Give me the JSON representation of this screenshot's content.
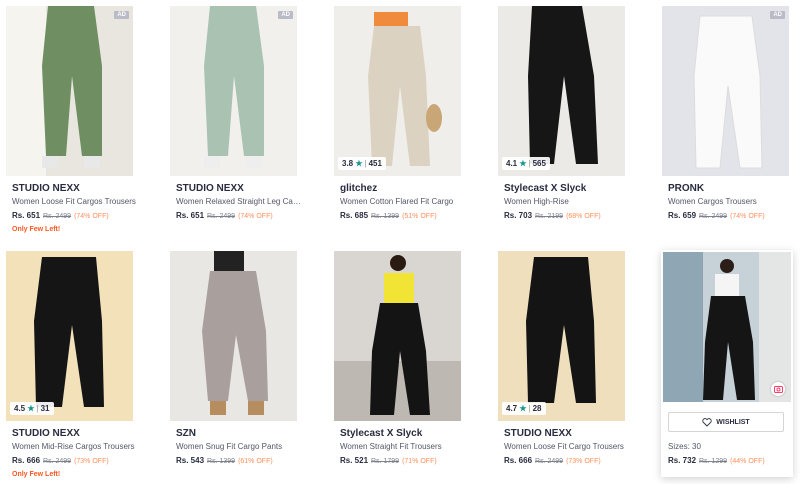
{
  "products": [
    {
      "brand": "STUDIO NEXX",
      "name": "Women Loose Fit Cargos Trousers",
      "price": "Rs. 651",
      "mrp": "Rs. 2499",
      "discount": "(74% OFF)",
      "ad": "AD",
      "note": "Only Few Left!"
    },
    {
      "brand": "STUDIO NEXX",
      "name": "Women Relaxed Straight Leg Cargos",
      "price": "Rs. 651",
      "mrp": "Rs. 2499",
      "discount": "(74% OFF)",
      "ad": "AD"
    },
    {
      "brand": "glitchez",
      "name": "Women Cotton Flared Fit Cargo",
      "price": "Rs. 685",
      "mrp": "Rs. 1399",
      "discount": "(51% OFF)",
      "rating": "3.8",
      "count": "451"
    },
    {
      "brand": "Stylecast X Slyck",
      "name": "Women High-Rise",
      "price": "Rs. 703",
      "mrp": "Rs. 2199",
      "discount": "(68% OFF)",
      "rating": "4.1",
      "count": "565"
    },
    {
      "brand": "PRONK",
      "name": "Women Cargos Trousers",
      "price": "Rs. 659",
      "mrp": "Rs. 2499",
      "discount": "(74% OFF)",
      "ad": "AD"
    },
    {
      "brand": "STUDIO NEXX",
      "name": "Women Mid-Rise Cargos Trousers",
      "price": "Rs. 666",
      "mrp": "Rs. 2499",
      "discount": "(73% OFF)",
      "rating": "4.5",
      "count": "31",
      "note": "Only Few Left!"
    },
    {
      "brand": "SZN",
      "name": "Women Snug Fit Cargo Pants",
      "price": "Rs. 543",
      "mrp": "Rs. 1399",
      "discount": "(61% OFF)"
    },
    {
      "brand": "Stylecast X Slyck",
      "name": "Women Straight Fit Trousers",
      "price": "Rs. 521",
      "mrp": "Rs. 1799",
      "discount": "(71% OFF)"
    },
    {
      "brand": "STUDIO NEXX",
      "name": "Women Loose Fit Cargo Trousers",
      "price": "Rs. 666",
      "mrp": "Rs. 2499",
      "discount": "(73% OFF)",
      "rating": "4.7",
      "count": "28"
    }
  ],
  "hover_card": {
    "wishlist": "WISHLIST",
    "sizes": "Sizes: 30",
    "price": "Rs. 732",
    "mrp": "Rs. 1299",
    "discount": "(44% OFF)"
  },
  "colors": {
    "rating_star": "#14958f",
    "discount": "#ff905a",
    "few_left": "#ff5722"
  },
  "icons": {
    "wishlist": "heart-icon",
    "rating": "star-icon",
    "visual_search": "camera-icon"
  }
}
